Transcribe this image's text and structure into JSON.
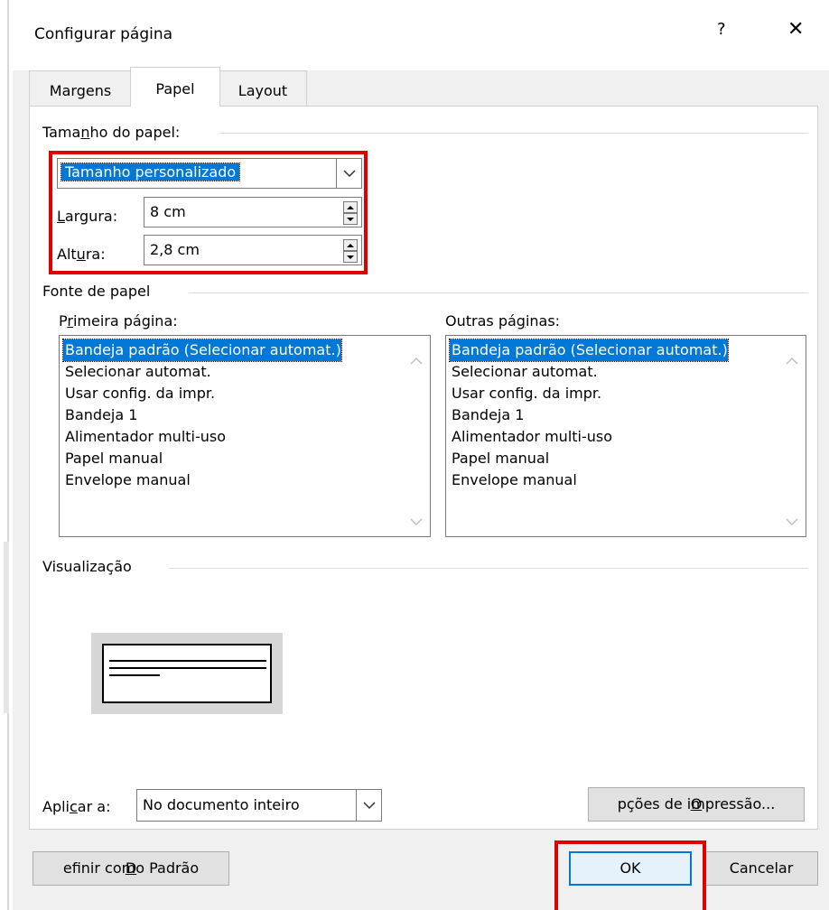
{
  "dialog": {
    "title": "Configurar página",
    "help_label": "?",
    "close_label": "✕"
  },
  "tabs": [
    {
      "label": "Margens",
      "active": false
    },
    {
      "label": "Papel",
      "active": true
    },
    {
      "label": "Layout",
      "active": false
    }
  ],
  "paper_size": {
    "section_label_pre": "Tama",
    "section_label_accel": "n",
    "section_label_post": "ho do papel:",
    "selected": "Tamanho personalizado",
    "width_label_accel": "L",
    "width_label_post": "argura:",
    "width_value": "8 cm",
    "height_label_pre": "Alt",
    "height_label_accel": "u",
    "height_label_post": "ra:",
    "height_value": "2,8 cm"
  },
  "paper_source": {
    "section_label": "Fonte de papel",
    "first_page": {
      "label_pre": "P",
      "label_accel": "r",
      "label_post": "imeira página:",
      "items": [
        "Bandeja padrão (Selecionar automat.)",
        "Selecionar automat.",
        "Usar config. da impr.",
        "Bandeja 1",
        "Alimentador multi-uso",
        "Papel manual",
        "Envelope manual"
      ],
      "selected_index": 0
    },
    "other_pages": {
      "label_pre": "Outras pá",
      "label_accel": "g",
      "label_post": "inas:",
      "items": [
        "Bandeja padrão (Selecionar automat.)",
        "Selecionar automat.",
        "Usar config. da impr.",
        "Bandeja 1",
        "Alimentador multi-uso",
        "Papel manual",
        "Envelope manual"
      ],
      "selected_index": 0
    }
  },
  "preview": {
    "section_label": "Visualização"
  },
  "apply": {
    "label_pre": "Apli",
    "label_accel": "c",
    "label_post": "ar a:",
    "selected": "No documento inteiro"
  },
  "buttons": {
    "print_options_accel": "O",
    "print_options_post": "pções de impressão...",
    "set_default_accel": "D",
    "set_default_post": "efinir como Padrão",
    "ok": "OK",
    "cancel": "Cancelar"
  },
  "colors": {
    "selection": "#0078d7",
    "highlight_box": "#e00000",
    "dialog_bg": "#f0f0f0"
  }
}
